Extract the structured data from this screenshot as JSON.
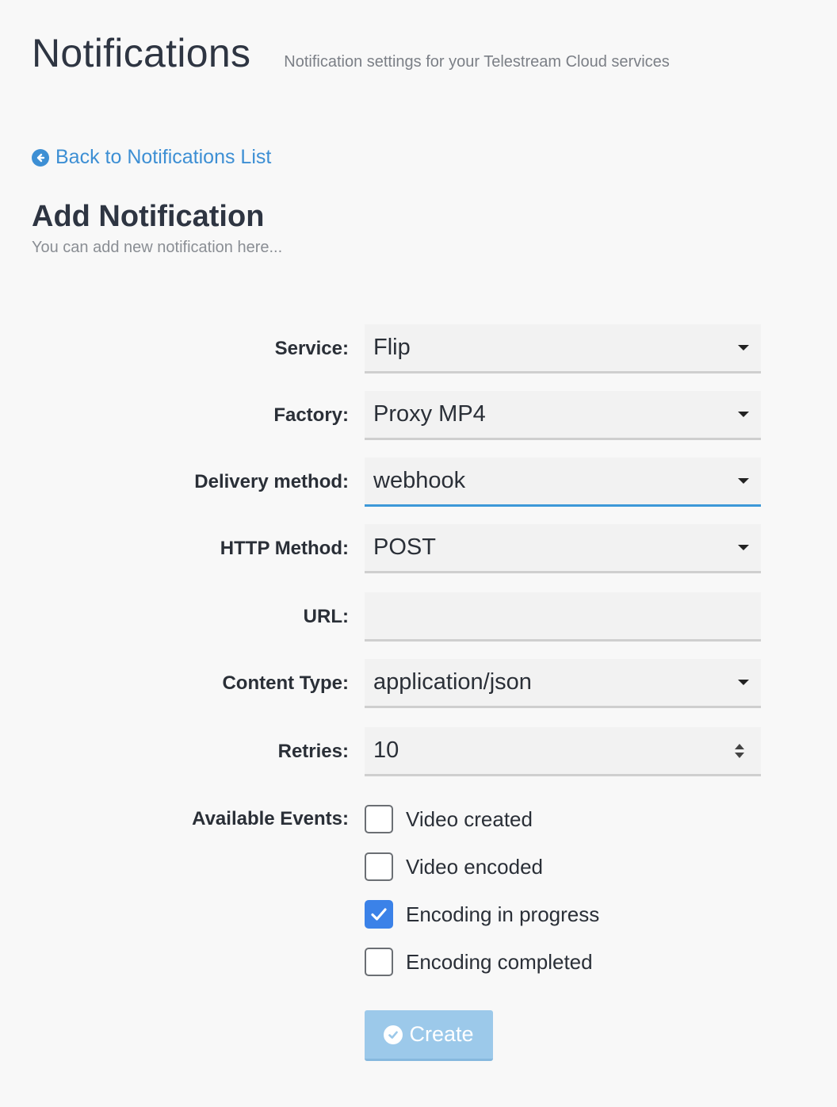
{
  "header": {
    "title": "Notifications",
    "subtitle": "Notification settings for your Telestream Cloud services"
  },
  "back_link": {
    "label": "Back to Notifications List",
    "icon": "arrow-circle-left-icon"
  },
  "section": {
    "title": "Add Notification",
    "subtitle": "You can add new notification here..."
  },
  "form": {
    "service": {
      "label": "Service:",
      "value": "Flip"
    },
    "factory": {
      "label": "Factory:",
      "value": "Proxy MP4"
    },
    "delivery_method": {
      "label": "Delivery method:",
      "value": "webhook"
    },
    "http_method": {
      "label": "HTTP Method:",
      "value": "POST"
    },
    "url": {
      "label": "URL:",
      "value": ""
    },
    "content_type": {
      "label": "Content Type:",
      "value": "application/json"
    },
    "retries": {
      "label": "Retries:",
      "value": "10"
    },
    "events": {
      "label": "Available Events:",
      "items": [
        {
          "label": "Video created",
          "checked": false
        },
        {
          "label": "Video encoded",
          "checked": false
        },
        {
          "label": "Encoding in progress",
          "checked": true
        },
        {
          "label": "Encoding completed",
          "checked": false
        }
      ]
    }
  },
  "create_button": {
    "label": "Create",
    "icon": "check-circle-icon"
  },
  "colors": {
    "accent": "#3d8fd4",
    "checkbox_checked": "#3b82e8",
    "button_disabled": "#9cc9ea",
    "background": "#f8f8f8"
  }
}
